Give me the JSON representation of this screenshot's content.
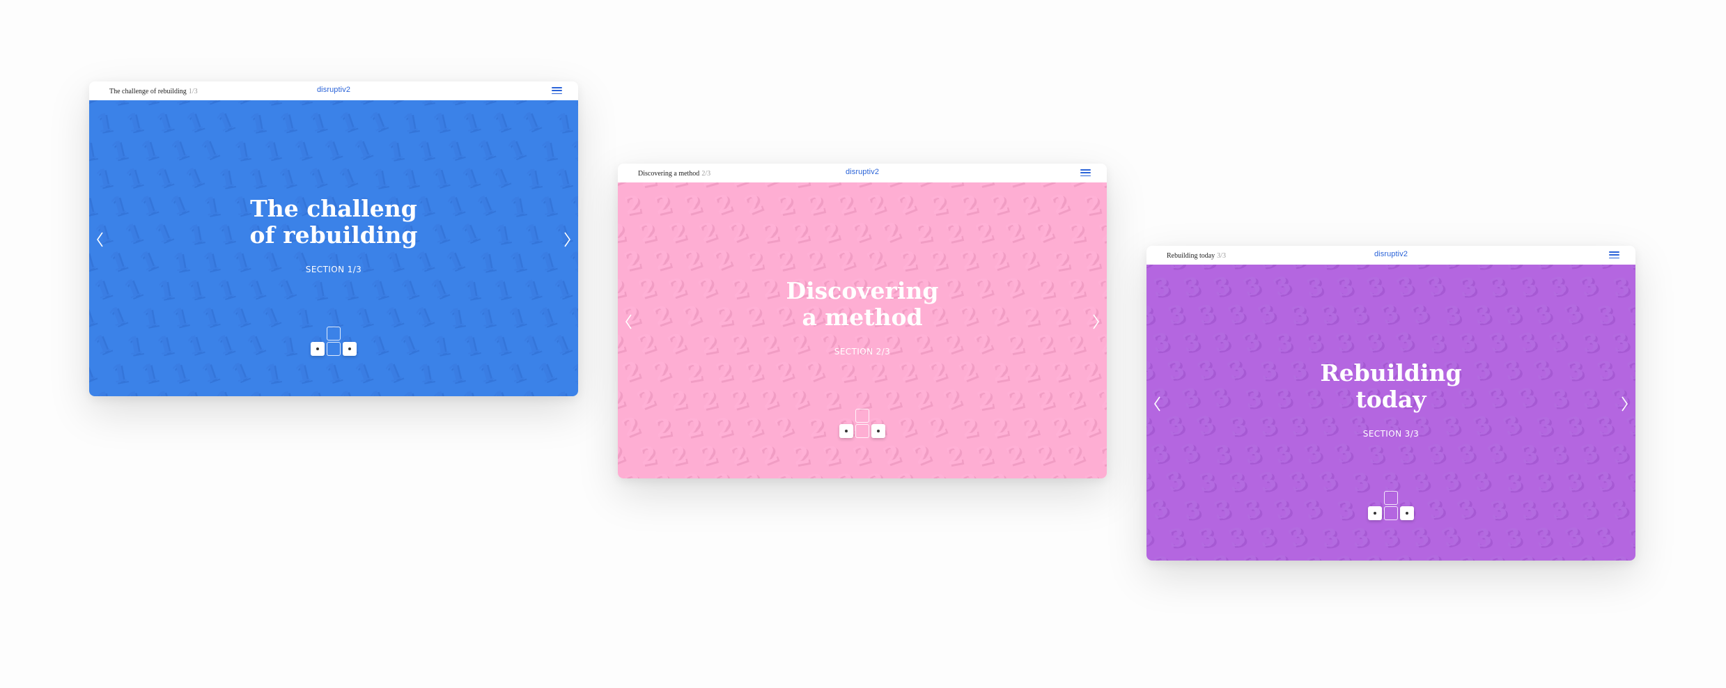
{
  "logo": "disruptiv2",
  "colors": {
    "logo": "#2a63d8",
    "menu_icon": "#2a63d8",
    "section_1": "#3b82e8",
    "section_2": "#feaed3",
    "section_3": "#b466e0"
  },
  "slides": [
    {
      "crumb_title": "The challenge of rebuilding",
      "crumb_count": "1/3",
      "headline_line1": "The challeng",
      "headline_line2": "of rebuilding",
      "section_label": "SECTION 1/3",
      "pattern_digit": "1",
      "background": "#3b82e8",
      "pattern_fill": "#3a7de3",
      "pattern_shadow": "#2f6bcc",
      "key_down_fill": "#3b82e8"
    },
    {
      "crumb_title": "Discovering a method",
      "crumb_count": "2/3",
      "headline_line1": "Discovering",
      "headline_line2": "a method",
      "section_label": "SECTION 2/3",
      "pattern_digit": "2",
      "background": "#feaed3",
      "pattern_fill": "#ffb1d6",
      "pattern_shadow": "#e58fb8",
      "key_down_fill": "#feaed3"
    },
    {
      "crumb_title": "Rebuilding today",
      "crumb_count": "3/3",
      "headline_line1": "Rebuilding",
      "headline_line2": "today",
      "section_label": "SECTION 3/3",
      "pattern_digit": "3",
      "background": "#b466e0",
      "pattern_fill": "#b36be0",
      "pattern_shadow": "#9a4fc8",
      "key_down_fill": "#b466e0"
    }
  ],
  "icons": {
    "menu": "hamburger-menu-icon",
    "prev": "chevron-left-icon",
    "next": "chevron-right-icon",
    "key_left": "arrow-key-left-icon",
    "key_right": "arrow-key-right-icon"
  }
}
